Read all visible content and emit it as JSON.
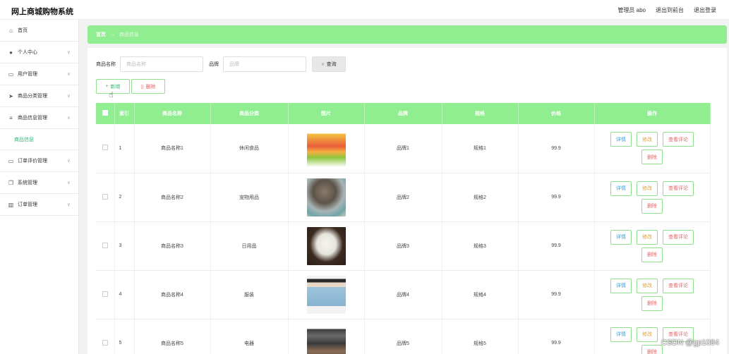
{
  "app": {
    "title": "网上商城购物系统"
  },
  "topbar": {
    "admin": "管理员 abo",
    "front": "退出到前台",
    "logout": "退出登录"
  },
  "sidebar": {
    "items": [
      {
        "label": "首页",
        "icon": "home-icon"
      },
      {
        "label": "个人中心",
        "icon": "user-icon"
      },
      {
        "label": "用户管理",
        "icon": "monitor-icon"
      },
      {
        "label": "商品分类管理",
        "icon": "send-icon"
      },
      {
        "label": "商品信息管理",
        "icon": "list-icon"
      },
      {
        "label": "订单评价管理",
        "icon": "monitor-icon"
      },
      {
        "label": "系统管理",
        "icon": "copy-icon"
      },
      {
        "label": "订单管理",
        "icon": "chart-icon"
      }
    ],
    "submenu": {
      "label": "商品信息"
    }
  },
  "breadcrumb": {
    "home": "首页",
    "current": "商品信息"
  },
  "search": {
    "name_label": "商品名称",
    "name_placeholder": "商品名称",
    "brand_label": "品牌",
    "brand_placeholder": "品牌",
    "button": "查询"
  },
  "actions": {
    "add": "新增",
    "delete": "删除"
  },
  "table": {
    "headers": [
      "索引",
      "商品名称",
      "商品分类",
      "图片",
      "品牌",
      "规格",
      "价格",
      "操作"
    ],
    "rows": [
      {
        "index": "1",
        "name": "商品名称1",
        "category": "休闲食品",
        "brand": "品牌1",
        "spec": "规格1",
        "price": "99.9"
      },
      {
        "index": "2",
        "name": "商品名称2",
        "category": "宠物用品",
        "brand": "品牌2",
        "spec": "规格2",
        "price": "99.9"
      },
      {
        "index": "3",
        "name": "商品名称3",
        "category": "日用品",
        "brand": "品牌3",
        "spec": "规格3",
        "price": "99.9"
      },
      {
        "index": "4",
        "name": "商品名称4",
        "category": "服装",
        "brand": "品牌4",
        "spec": "规格4",
        "price": "99.9"
      },
      {
        "index": "5",
        "name": "商品名称5",
        "category": "电器",
        "brand": "品牌5",
        "spec": "规格5",
        "price": "99.9"
      }
    ],
    "ops": {
      "detail": "详情",
      "edit": "修改",
      "review": "查看评论",
      "delete": "删除"
    }
  },
  "watermark": "CSDN @gp1084",
  "colors": {
    "accent": "#90ee90",
    "active_menu": "#2bb673"
  }
}
